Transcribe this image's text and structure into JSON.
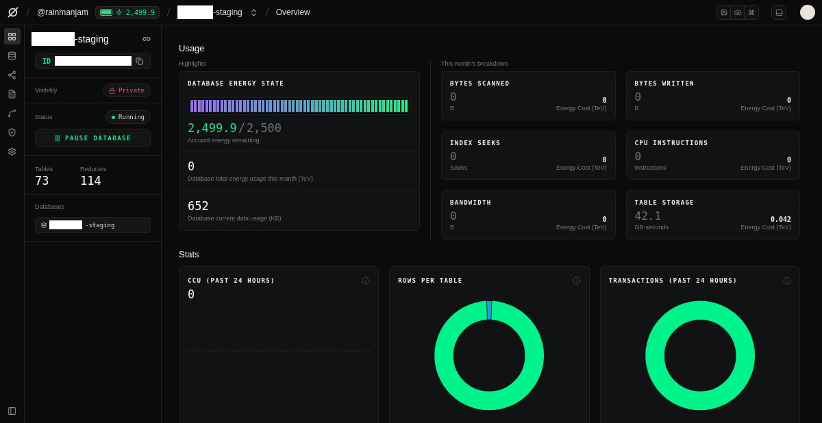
{
  "topbar": {
    "user": "@rainmanjam",
    "energy": "2,499.9",
    "project": "-staging",
    "page": "Overview"
  },
  "nav": [
    {
      "kind": "overview",
      "selected": true
    },
    {
      "kind": "tables",
      "selected": false
    },
    {
      "kind": "graph",
      "selected": false
    },
    {
      "kind": "logs",
      "selected": false
    },
    {
      "kind": "metrics",
      "selected": false
    },
    {
      "kind": "security",
      "selected": false
    },
    {
      "kind": "settings",
      "selected": false
    }
  ],
  "sidebar": {
    "project_name": "-staging",
    "id_label": "ID",
    "visibility": {
      "label": "Visibility",
      "value": "Private"
    },
    "status": {
      "label": "Status",
      "value": "Running",
      "running": true
    },
    "pause_button": "PAUSE DATABASE",
    "counts": [
      {
        "label": "Tables",
        "value": "73"
      },
      {
        "label": "Reducers",
        "value": "114"
      }
    ],
    "databases": {
      "label": "Databases",
      "items": [
        {
          "name": "-staging"
        }
      ]
    }
  },
  "usage": {
    "title": "Usage",
    "highlights_label": "Highlights",
    "energy": {
      "title": "DATABASE ENERGY STATE",
      "level": 1.0,
      "remaining": "2,499.9",
      "separator": "/",
      "total": "2,500",
      "caption": "Account energy remaining"
    },
    "metrics": [
      {
        "value": "0",
        "caption": "Database total energy usage this month (TeV)"
      },
      {
        "value": "652",
        "caption": "Database current data usage (KB)"
      }
    ],
    "breakdown_label": "This month's breakdown",
    "breakdown": [
      {
        "title": "BYTES SCANNED",
        "value": "0",
        "unit": "B",
        "cost": "0",
        "cost_label": "Energy Cost (TeV)"
      },
      {
        "title": "BYTES WRITTEN",
        "value": "0",
        "unit": "B",
        "cost": "0",
        "cost_label": "Energy Cost (TeV)"
      },
      {
        "title": "INDEX SEEKS",
        "value": "0",
        "unit": "Seeks",
        "cost": "0",
        "cost_label": "Energy Cost (TeV)"
      },
      {
        "title": "CPU INSTRUCTIONS",
        "value": "0",
        "unit": "Instructions",
        "cost": "0",
        "cost_label": "Energy Cost (TeV)"
      },
      {
        "title": "BANDWIDTH",
        "value": "0",
        "unit": "B",
        "cost": "0",
        "cost_label": "Energy Cost (TeV)"
      },
      {
        "title": "TABLE STORAGE",
        "value": "42.1",
        "unit": "GB-seconds",
        "cost": "0.042",
        "cost_label": "Energy Cost (TeV)"
      }
    ]
  },
  "stats": {
    "title": "Stats",
    "cards": [
      {
        "title": "CCU (PAST 24 HOURS)",
        "kind": "line",
        "value": "0"
      },
      {
        "title": "ROWS PER TABLE",
        "kind": "segmented_donut"
      },
      {
        "title": "TRANSACTIONS (PAST 24 HOURS)",
        "kind": "donut"
      }
    ]
  }
}
